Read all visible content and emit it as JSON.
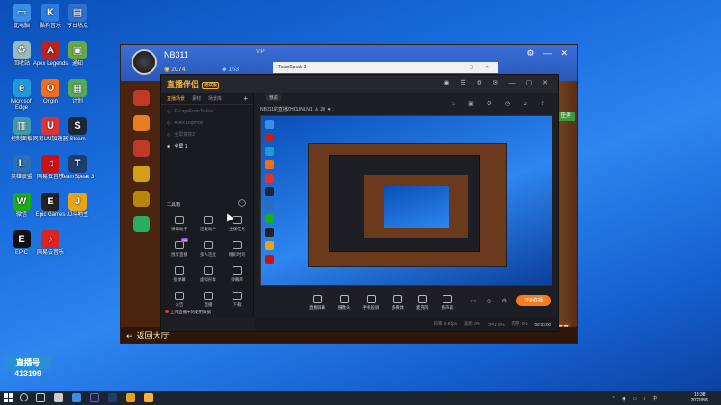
{
  "desktop": {
    "icons": [
      {
        "label": "此电脑",
        "color": "#3a8ee6",
        "glyph": "▭"
      },
      {
        "label": "酷狗音乐",
        "color": "#2a7de1",
        "glyph": "K"
      },
      {
        "label": "今日热点",
        "color": "#2f6fd0",
        "glyph": "▤"
      },
      {
        "label": "回收站",
        "color": "#9bb",
        "glyph": "♻"
      },
      {
        "label": "Apex Legends",
        "color": "#b22",
        "glyph": "A"
      },
      {
        "label": "通知",
        "color": "#6a4",
        "glyph": "▣"
      },
      {
        "label": "Microsoft Edge",
        "color": "#1e9bd6",
        "glyph": "e"
      },
      {
        "label": "Origin",
        "color": "#f56c1a",
        "glyph": "O"
      },
      {
        "label": "计划",
        "color": "#5a5",
        "glyph": "▦"
      },
      {
        "label": "控制面板",
        "color": "#49a",
        "glyph": "▥"
      },
      {
        "label": "网易UU加速器",
        "color": "#d33",
        "glyph": "U"
      },
      {
        "label": "Steam",
        "color": "#1b2838",
        "glyph": "S"
      },
      {
        "label": "英雄联盟",
        "color": "#2c6fb8",
        "glyph": "L"
      },
      {
        "label": "网易云音乐",
        "color": "#c11",
        "glyph": "♫"
      },
      {
        "label": "TeamSpeak 3",
        "color": "#1f3c6e",
        "glyph": "T"
      },
      {
        "label": "微信",
        "color": "#1aad19",
        "glyph": "W"
      },
      {
        "label": "Epic Games",
        "color": "#222",
        "glyph": "E"
      },
      {
        "label": "JJ斗地主",
        "color": "#e8a317",
        "glyph": "J"
      },
      {
        "label": "EPIC",
        "color": "#111",
        "glyph": "E"
      },
      {
        "label": "网易云音乐",
        "color": "#d22",
        "glyph": "♪"
      }
    ]
  },
  "game": {
    "player_name": "NB311",
    "coins": "2074",
    "gems": "163",
    "vip": "VIP",
    "back_label": "返回大厅",
    "right_tab": "任务",
    "bottom_right": "赛事"
  },
  "teamspeak": {
    "title": "TeamSpeak 3"
  },
  "app": {
    "title": "直播伴侣",
    "beta": "测试版",
    "left_tabs": [
      "直播场景",
      "素材",
      "场景库"
    ],
    "scenes": [
      {
        "name": "EscapeFromTarkov"
      },
      {
        "name": "Apex Legends"
      },
      {
        "name": "全屏捕获2"
      },
      {
        "name": "全屏 1"
      }
    ],
    "tools_title": "工具箱",
    "tools": [
      {
        "label": "弹幕助手",
        "badge": ""
      },
      {
        "label": "连麦助手",
        "badge": ""
      },
      {
        "label": "主播任务",
        "badge": ""
      },
      {
        "label": "悦享直播",
        "badge": "new"
      },
      {
        "label": "多人连麦",
        "badge": ""
      },
      {
        "label": "精彩时刻",
        "badge": ""
      },
      {
        "label": "投弹幕",
        "badge": ""
      },
      {
        "label": "虚拟形象",
        "badge": ""
      },
      {
        "label": "弹幕库",
        "badge": ""
      },
      {
        "label": "公告",
        "badge": ""
      },
      {
        "label": "直播",
        "badge": ""
      },
      {
        "label": "下载",
        "badge": ""
      }
    ],
    "left_footer": "上传直播中的使用数据",
    "preview_tab": "预览",
    "room_info": "NB311的直播ZHOUNUN1",
    "room_viewers": "20",
    "room_likes": "1",
    "controls": [
      {
        "label": "直播屏幕"
      },
      {
        "label": "摄像头"
      },
      {
        "label": "手机投屏"
      },
      {
        "label": "多媒体"
      },
      {
        "label": "麦克风"
      },
      {
        "label": "扬声器"
      }
    ],
    "live_button": "开始直播",
    "status": [
      "码率: 0 Kbps",
      "丢帧: 0%",
      "CPU: 0%",
      "内存: 0%"
    ],
    "timer": "00:00:00"
  },
  "watermark": {
    "line1": "直播号",
    "line2": "413199"
  },
  "taskbar": {
    "time": "19:38",
    "date": "2022/8/5"
  },
  "colors": {
    "accent": "#f5b33a",
    "live": "#f57c1f"
  }
}
